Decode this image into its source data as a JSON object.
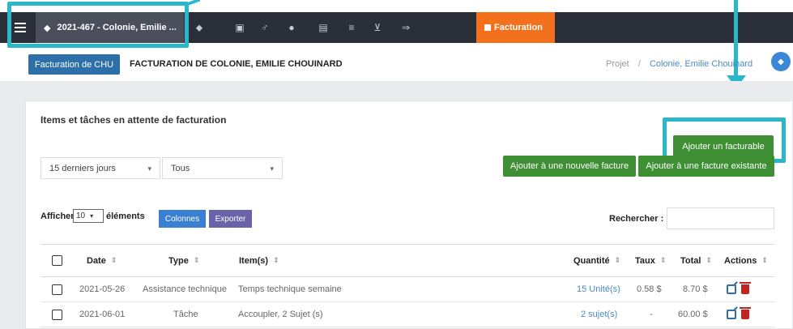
{
  "topnav": {
    "project_tab_label": "2021-467 - Colonie, Emilie ...",
    "billing_tab_label": "Facturation"
  },
  "header": {
    "chu_button": "Facturation de CHU",
    "title": "FACTURATION DE COLONIE, EMILIE CHOUINARD",
    "breadcrumb_root": "Projet",
    "breadcrumb_sep": "/",
    "breadcrumb_current": "Colonie, Emilie Chouinard"
  },
  "card": {
    "title": "Items et tâches en attente de facturation",
    "add_billable": "Ajouter un facturable",
    "period_select": "15 derniers jours",
    "type_select": "Tous",
    "add_new_invoice": "Ajouter à une nouvelle facture",
    "add_existing_invoice": "Ajouter à une facture existante",
    "show_prefix": "Afficher",
    "show_count": "10",
    "show_suffix": "éléments",
    "columns_button": "Colonnes",
    "export_button": "Exporter",
    "search_label": "Rechercher :"
  },
  "table": {
    "headers": {
      "date": "Date",
      "type": "Type",
      "items": "Item(s)",
      "quantity": "Quantité",
      "rate": "Taux",
      "total": "Total",
      "actions": "Actions"
    },
    "rows": [
      {
        "date": "2021-05-26",
        "type": "Assistance technique",
        "item": "Temps technique semaine",
        "quantity": "15 Unité(s)",
        "rate": "0.58 $",
        "total": "8.70 $"
      },
      {
        "date": "2021-06-01",
        "type": "Tâche",
        "item": "Accoupler, 2 Sujet (s)",
        "quantity": "2 sujet(s)",
        "rate": "-",
        "total": "60.00 $"
      }
    ]
  },
  "colors": {
    "nav_bg": "#2b2f3a",
    "billing_tab": "#f3711d",
    "highlight": "#2ab7c9",
    "green": "#3f8f34",
    "blue": "#2d6fa8"
  }
}
